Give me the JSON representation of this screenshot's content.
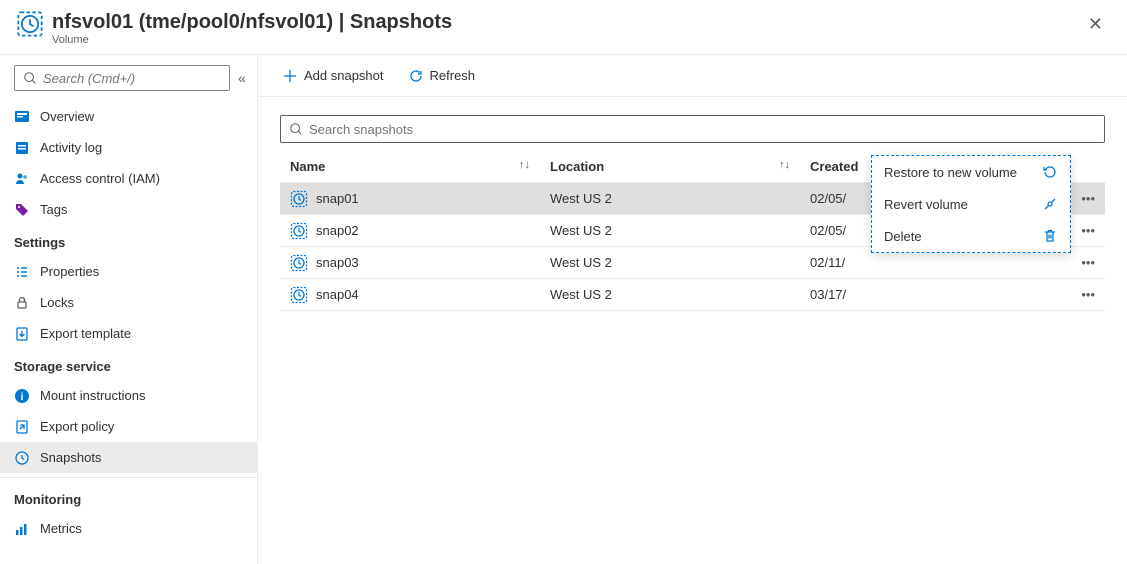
{
  "header": {
    "title": "nfsvol01 (tme/pool0/nfsvol01) | Snapshots",
    "subtitle": "Volume"
  },
  "sidebar": {
    "search_placeholder": "Search (Cmd+/)",
    "items": [
      {
        "label": "Overview",
        "icon": "overview"
      },
      {
        "label": "Activity log",
        "icon": "activity-log"
      },
      {
        "label": "Access control (IAM)",
        "icon": "access-control"
      },
      {
        "label": "Tags",
        "icon": "tags"
      }
    ],
    "sections": [
      {
        "title": "Settings",
        "items": [
          {
            "label": "Properties",
            "icon": "properties"
          },
          {
            "label": "Locks",
            "icon": "locks"
          },
          {
            "label": "Export template",
            "icon": "export-template"
          }
        ]
      },
      {
        "title": "Storage service",
        "items": [
          {
            "label": "Mount instructions",
            "icon": "mount"
          },
          {
            "label": "Export policy",
            "icon": "export-policy"
          },
          {
            "label": "Snapshots",
            "icon": "snapshots",
            "active": true
          }
        ]
      },
      {
        "title": "Monitoring",
        "items": [
          {
            "label": "Metrics",
            "icon": "metrics"
          }
        ]
      }
    ]
  },
  "toolbar": {
    "add_label": "Add snapshot",
    "refresh_label": "Refresh"
  },
  "table": {
    "search_placeholder": "Search snapshots",
    "columns": {
      "name": "Name",
      "location": "Location",
      "created": "Created"
    },
    "rows": [
      {
        "name": "snap01",
        "location": "West US 2",
        "created": "02/05/",
        "selected": true
      },
      {
        "name": "snap02",
        "location": "West US 2",
        "created": "02/05/"
      },
      {
        "name": "snap03",
        "location": "West US 2",
        "created": "02/11/"
      },
      {
        "name": "snap04",
        "location": "West US 2",
        "created": "03/17/"
      }
    ]
  },
  "context_menu": {
    "restore": "Restore to new volume",
    "revert": "Revert volume",
    "delete": "Delete"
  }
}
